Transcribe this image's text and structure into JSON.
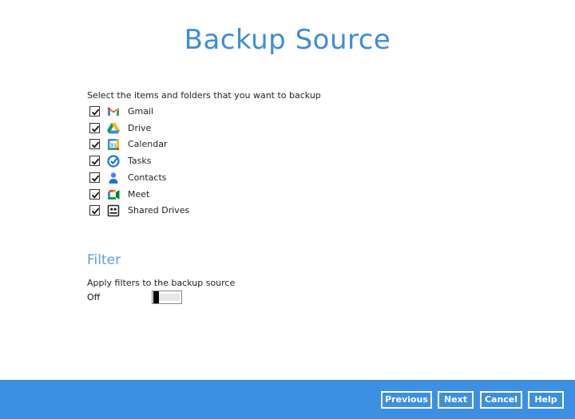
{
  "page": {
    "title": "Backup Source",
    "instruction": "Select the items and folders that you want to backup"
  },
  "items": [
    {
      "label": "Gmail",
      "checked": true,
      "icon": "gmail-icon"
    },
    {
      "label": "Drive",
      "checked": true,
      "icon": "drive-icon"
    },
    {
      "label": "Calendar",
      "checked": true,
      "icon": "calendar-icon"
    },
    {
      "label": "Tasks",
      "checked": true,
      "icon": "tasks-icon"
    },
    {
      "label": "Contacts",
      "checked": true,
      "icon": "contacts-icon"
    },
    {
      "label": "Meet",
      "checked": true,
      "icon": "meet-icon"
    },
    {
      "label": "Shared Drives",
      "checked": true,
      "icon": "shared-drives-icon"
    }
  ],
  "filter": {
    "heading": "Filter",
    "description": "Apply filters to the backup source",
    "toggle_label": "Off",
    "toggle_on": false
  },
  "footer": {
    "previous": "Previous",
    "next": "Next",
    "cancel": "Cancel",
    "help": "Help"
  },
  "colors": {
    "accent": "#3c8dde",
    "footer": "#3d8fe3"
  }
}
